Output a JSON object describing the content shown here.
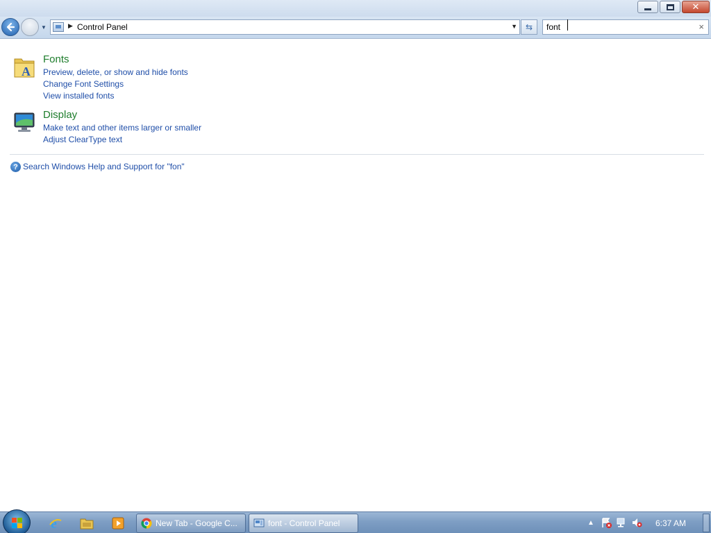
{
  "window": {
    "minimize_glyph": "",
    "close_glyph": "✕"
  },
  "navbar": {
    "address_text": "Control Panel",
    "search_value": "font",
    "search_clear": "×"
  },
  "groups": [
    {
      "title": "Fonts",
      "icon": "fonts-folder-icon",
      "links": [
        "Preview, delete, or show and hide fonts",
        "Change Font Settings",
        "View installed fonts"
      ]
    },
    {
      "title": "Display",
      "icon": "display-monitor-icon",
      "links": [
        "Make text and other items larger or smaller",
        "Adjust ClearType text"
      ]
    }
  ],
  "help": {
    "icon_glyph": "?",
    "text": "Search Windows Help and Support for \"fon\""
  },
  "taskbar": {
    "pinned": [
      "internet-explorer-icon",
      "windows-explorer-icon",
      "media-player-icon"
    ],
    "tasks": [
      {
        "label": "New Tab - Google C...",
        "icon": "chrome-icon",
        "active": false
      },
      {
        "label": "font - Control Panel",
        "icon": "control-panel-icon",
        "active": true
      }
    ],
    "clock": "6:37 AM"
  },
  "colors": {
    "group_title": "#1e7d2c",
    "link": "#1f4ea8",
    "taskbar": "#7e9ec4"
  }
}
